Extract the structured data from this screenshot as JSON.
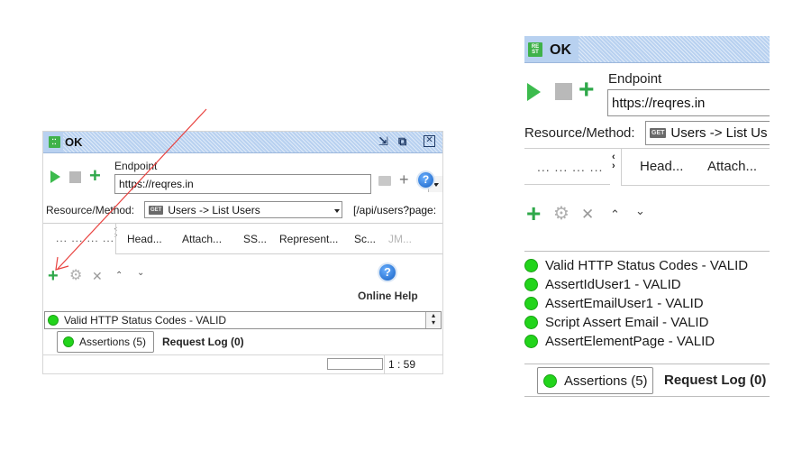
{
  "left_panel": {
    "title": "OK",
    "rest_icon_text": "RE ST",
    "window_controls": [
      "restore-icon",
      "maximize-icon",
      "close-icon"
    ],
    "toolbar": {
      "run_icon": "play-icon",
      "stop_icon": "stop-icon",
      "add_icon": "plus-icon"
    },
    "endpoint_label": "Endpoint",
    "endpoint_value": "https://reqres.in",
    "resource_method_label": "Resource/Method:",
    "resource_method_badge": "GET",
    "resource_method_value": "Users -> List Users",
    "api_path": "[/api/users?page:",
    "tabs_overflow": "... ... ... ...",
    "tabs": [
      {
        "label": "Head...",
        "enabled": true
      },
      {
        "label": "Attach...",
        "enabled": true
      },
      {
        "label": "SS...",
        "enabled": true
      },
      {
        "label": "Represent...",
        "enabled": true
      },
      {
        "label": "Sc...",
        "enabled": true
      },
      {
        "label": "JM...",
        "enabled": false
      }
    ],
    "assertion_toolbar": [
      "add-icon",
      "gear-icon",
      "delete-icon",
      "move-up-icon",
      "move-down-icon"
    ],
    "online_help_label": "Online Help",
    "selected_assertion": "Valid HTTP Status Codes - VALID",
    "bottom_tabs": {
      "assertions": "Assertions (5)",
      "request_log": "Request Log (0)"
    },
    "status_position": "1 : 59"
  },
  "right_panel": {
    "title": "OK",
    "rest_icon_text": "RE ST",
    "endpoint_label": "Endpoint",
    "endpoint_value": "https://reqres.in",
    "resource_method_label": "Resource/Method:",
    "resource_method_badge": "GET",
    "resource_method_value": "Users -> List Us",
    "tabs_overflow": "... ... ... ...",
    "tabs": [
      {
        "label": "Head..."
      },
      {
        "label": "Attach..."
      }
    ],
    "assertions": [
      {
        "label": "Valid HTTP Status Codes - VALID",
        "status": "valid"
      },
      {
        "label": "AssertIdUser1 - VALID",
        "status": "valid"
      },
      {
        "label": "AssertEmailUser1 - VALID",
        "status": "valid"
      },
      {
        "label": "Script Assert Email - VALID",
        "status": "valid"
      },
      {
        "label": "AssertElementPage - VALID",
        "status": "valid"
      }
    ],
    "bottom_tabs": {
      "assertions": "Assertions (5)",
      "request_log": "Request Log (0)"
    }
  },
  "annotation": {
    "type": "arrow",
    "color": "#e8423f",
    "points_to": "add-assertion-button"
  },
  "colors": {
    "title_bar": "#b8d1f0",
    "valid_dot": "#22d41b",
    "add_green": "#2fa84a",
    "play_green": "#3cbb4d"
  }
}
